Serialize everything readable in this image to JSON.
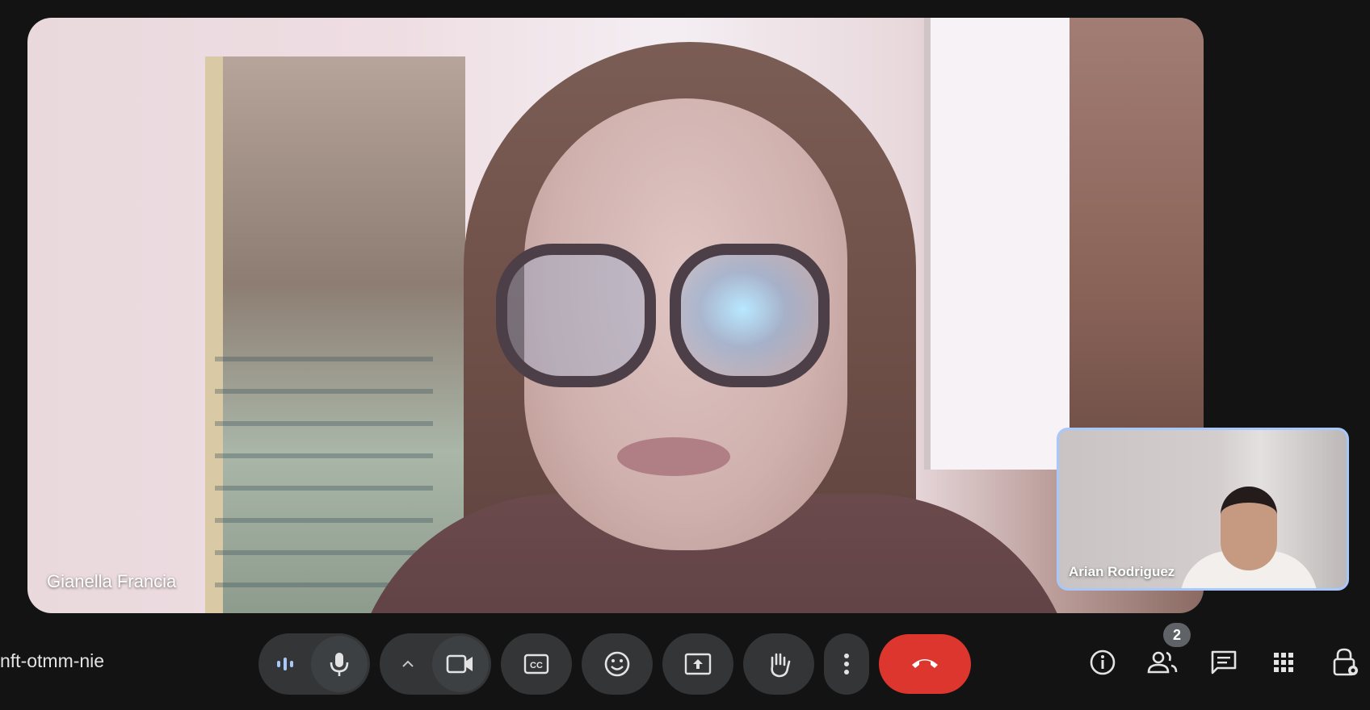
{
  "participants": {
    "main": {
      "name": "Gianella Francia"
    },
    "self": {
      "name": "Arian Rodriguez"
    }
  },
  "meeting": {
    "code": "nft-otmm-nie"
  },
  "controls": {
    "audio_level": "audio-level-icon",
    "mic": "microphone-icon",
    "camera_options": "chevron-up-icon",
    "camera": "video-camera-icon",
    "captions": "closed-captions-icon",
    "reactions": "emoji-icon",
    "present": "present-screen-icon",
    "raise_hand": "raise-hand-icon",
    "more": "more-options-icon",
    "end_call": "end-call-icon"
  },
  "side_controls": {
    "info": "info-icon",
    "people": "people-icon",
    "people_count": "2",
    "chat": "chat-icon",
    "activities": "apps-grid-icon",
    "host_controls": "host-controls-lock-icon"
  },
  "colors": {
    "background": "#131314",
    "button": "#333537",
    "end_call": "#dc362e",
    "self_border": "#a8c7fa"
  }
}
